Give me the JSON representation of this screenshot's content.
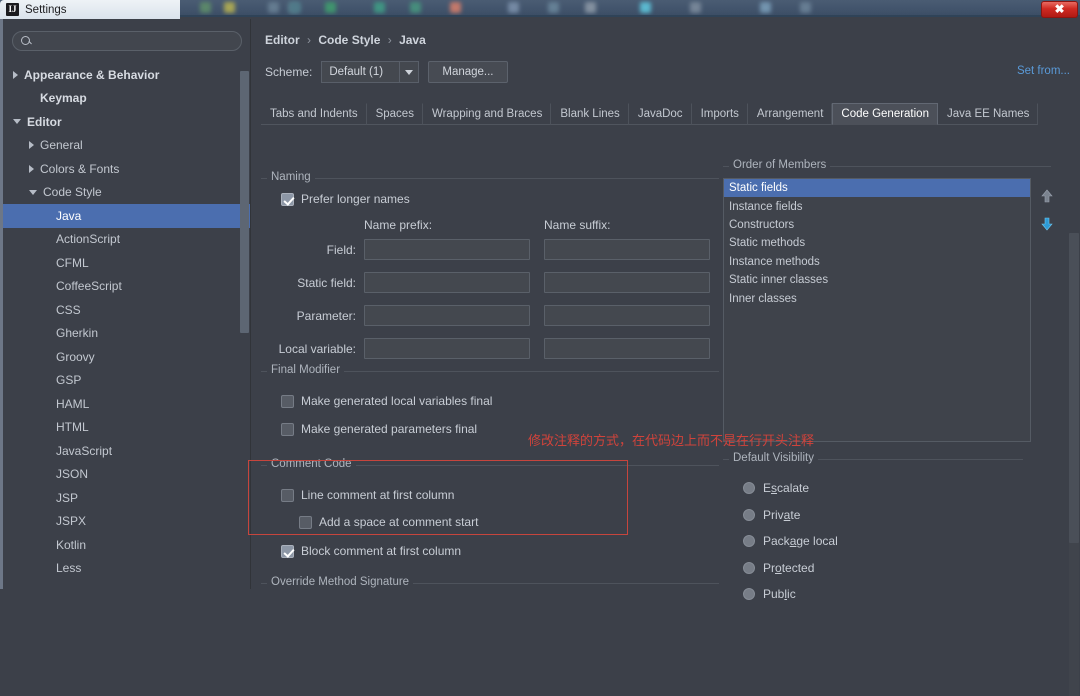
{
  "window": {
    "title": "Settings",
    "app_icon": "intellij-icon",
    "close_label": "✖"
  },
  "sidebar": {
    "search": {
      "value": "",
      "placeholder": "",
      "icon": "search-icon"
    },
    "items": [
      {
        "label": "Appearance & Behavior",
        "indent": 0,
        "twisty": "right",
        "bold": true,
        "selected": false
      },
      {
        "label": "Keymap",
        "indent": 1,
        "twisty": "none",
        "bold": true,
        "selected": false
      },
      {
        "label": "Editor",
        "indent": 0,
        "twisty": "down",
        "bold": true,
        "selected": false
      },
      {
        "label": "General",
        "indent": 1,
        "twisty": "right",
        "bold": false,
        "selected": false
      },
      {
        "label": "Colors & Fonts",
        "indent": 1,
        "twisty": "right",
        "bold": false,
        "selected": false
      },
      {
        "label": "Code Style",
        "indent": 1,
        "twisty": "down",
        "bold": false,
        "selected": false
      },
      {
        "label": "Java",
        "indent": 2,
        "twisty": "none",
        "bold": false,
        "selected": true
      },
      {
        "label": "ActionScript",
        "indent": 2,
        "twisty": "none",
        "bold": false,
        "selected": false
      },
      {
        "label": "CFML",
        "indent": 2,
        "twisty": "none",
        "bold": false,
        "selected": false
      },
      {
        "label": "CoffeeScript",
        "indent": 2,
        "twisty": "none",
        "bold": false,
        "selected": false
      },
      {
        "label": "CSS",
        "indent": 2,
        "twisty": "none",
        "bold": false,
        "selected": false
      },
      {
        "label": "Gherkin",
        "indent": 2,
        "twisty": "none",
        "bold": false,
        "selected": false
      },
      {
        "label": "Groovy",
        "indent": 2,
        "twisty": "none",
        "bold": false,
        "selected": false
      },
      {
        "label": "GSP",
        "indent": 2,
        "twisty": "none",
        "bold": false,
        "selected": false
      },
      {
        "label": "HAML",
        "indent": 2,
        "twisty": "none",
        "bold": false,
        "selected": false
      },
      {
        "label": "HTML",
        "indent": 2,
        "twisty": "none",
        "bold": false,
        "selected": false
      },
      {
        "label": "JavaScript",
        "indent": 2,
        "twisty": "none",
        "bold": false,
        "selected": false
      },
      {
        "label": "JSON",
        "indent": 2,
        "twisty": "none",
        "bold": false,
        "selected": false
      },
      {
        "label": "JSP",
        "indent": 2,
        "twisty": "none",
        "bold": false,
        "selected": false
      },
      {
        "label": "JSPX",
        "indent": 2,
        "twisty": "none",
        "bold": false,
        "selected": false
      },
      {
        "label": "Kotlin",
        "indent": 2,
        "twisty": "none",
        "bold": false,
        "selected": false
      },
      {
        "label": "Less",
        "indent": 2,
        "twisty": "none",
        "bold": false,
        "selected": false
      }
    ]
  },
  "main": {
    "breadcrumb": {
      "root": "Editor",
      "level2": "Code Style",
      "level3": "Java",
      "separator": "›"
    },
    "scheme": {
      "label": "Scheme:",
      "value": "Default (1)",
      "manage_label": "Manage..."
    },
    "set_from_link": "Set from...",
    "tabs": [
      {
        "label": "Tabs and Indents",
        "active": false
      },
      {
        "label": "Spaces",
        "active": false
      },
      {
        "label": "Wrapping and Braces",
        "active": false
      },
      {
        "label": "Blank Lines",
        "active": false
      },
      {
        "label": "JavaDoc",
        "active": false
      },
      {
        "label": "Imports",
        "active": false
      },
      {
        "label": "Arrangement",
        "active": false
      },
      {
        "label": "Code Generation",
        "active": true
      },
      {
        "label": "Java EE Names",
        "active": false
      }
    ],
    "naming": {
      "title": "Naming",
      "prefer_longer_names": {
        "label": "Prefer longer names",
        "checked": true
      },
      "col_prefix": "Name prefix:",
      "col_suffix": "Name suffix:",
      "rows": [
        {
          "label": "Field:",
          "prefix": "",
          "suffix": ""
        },
        {
          "label": "Static field:",
          "prefix": "",
          "suffix": ""
        },
        {
          "label": "Parameter:",
          "prefix": "",
          "suffix": ""
        },
        {
          "label": "Local variable:",
          "prefix": "",
          "suffix": ""
        }
      ]
    },
    "final_modifier": {
      "title": "Final Modifier",
      "options": [
        {
          "label": "Make generated local variables final",
          "checked": false
        },
        {
          "label": "Make generated parameters final",
          "checked": false
        }
      ]
    },
    "comment_code": {
      "title": "Comment Code",
      "options": [
        {
          "label": "Line comment at first column",
          "checked": false,
          "indent": 0
        },
        {
          "label": "Add a space at comment start",
          "checked": false,
          "indent": 1
        },
        {
          "label": "Block comment at first column",
          "checked": true,
          "indent": 0
        }
      ]
    },
    "override_method_signature": {
      "title": "Override Method Signature"
    },
    "order_of_members": {
      "title": "Order of Members",
      "items": [
        {
          "label": "Static fields",
          "selected": true
        },
        {
          "label": "Instance fields",
          "selected": false
        },
        {
          "label": "Constructors",
          "selected": false
        },
        {
          "label": "Static methods",
          "selected": false
        },
        {
          "label": "Instance methods",
          "selected": false
        },
        {
          "label": "Static inner classes",
          "selected": false
        },
        {
          "label": "Inner classes",
          "selected": false
        }
      ],
      "move_up_icon": "arrow-up-icon",
      "move_down_icon": "arrow-down-icon"
    },
    "default_visibility": {
      "title": "Default Visibility",
      "options": [
        {
          "label": "Escalate",
          "mnemonic_index": 1,
          "selected": false
        },
        {
          "label": "Private",
          "mnemonic_index": 4,
          "selected": false
        },
        {
          "label": "Package local",
          "mnemonic_index": 4,
          "selected": false
        },
        {
          "label": "Protected",
          "mnemonic_index": 2,
          "selected": false
        },
        {
          "label": "Public",
          "mnemonic_index": 3,
          "selected": false
        }
      ]
    }
  },
  "annotation": {
    "text": "修改注释的方式，在代码边上而不是在行开头注释",
    "color": "#d0433b"
  },
  "colors": {
    "accent_selection": "#4b6eaf",
    "link": "#5a9ad8",
    "annotation_red": "#d0433b",
    "panel_bg": "#3c4049",
    "window_border": "#6d7787"
  }
}
